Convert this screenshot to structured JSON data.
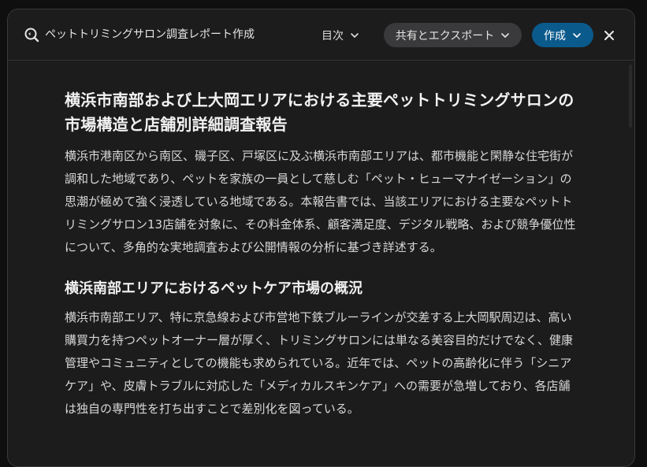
{
  "header": {
    "app_icon": "search-document-icon",
    "title": "ペットトリミングサロン調査レポート作成",
    "toc_label": "目次",
    "share_label": "共有とエクスポート",
    "create_label": "作成",
    "close_icon": "close-icon"
  },
  "document": {
    "title": "横浜市南部および上大岡エリアにおける主要ペットトリミングサロンの市場構造と店舗別詳細調査報告",
    "intro": "横浜市港南区から南区、磯子区、戸塚区に及ぶ横浜市南部エリアは、都市機能と閑静な住宅街が調和した地域であり、ペットを家族の一員として慈しむ「ペット・ヒューマナイゼーション」の思潮が極めて強く浸透している地域である。本報告書では、当該エリアにおける主要なペットトリミングサロン13店舗を対象に、その料金体系、顧客満足度、デジタル戦略、および競争優位性について、多角的な実地調査および公開情報の分析に基づき詳述する。",
    "section1_heading": "横浜南部エリアにおけるペットケア市場の概況",
    "section1_body": "横浜市南部エリア、特に京急線および市営地下鉄ブルーラインが交差する上大岡駅周辺は、高い購買力を持つペットオーナー層が厚く、トリミングサロンには単なる美容目的だけでなく、健康管理やコミュニティとしての機能も求められている。近年では、ペットの高齢化に伴う「シニアケア」や、皮膚トラブルに対応した「メディカルスキンケア」への需要が急増しており、各店舗は独自の専門性を打ち出すことで差別化を図っている。"
  },
  "colors": {
    "background": "#1c1c1d",
    "accent": "#0b5a8c",
    "secondary_button": "#3a3a3c"
  }
}
